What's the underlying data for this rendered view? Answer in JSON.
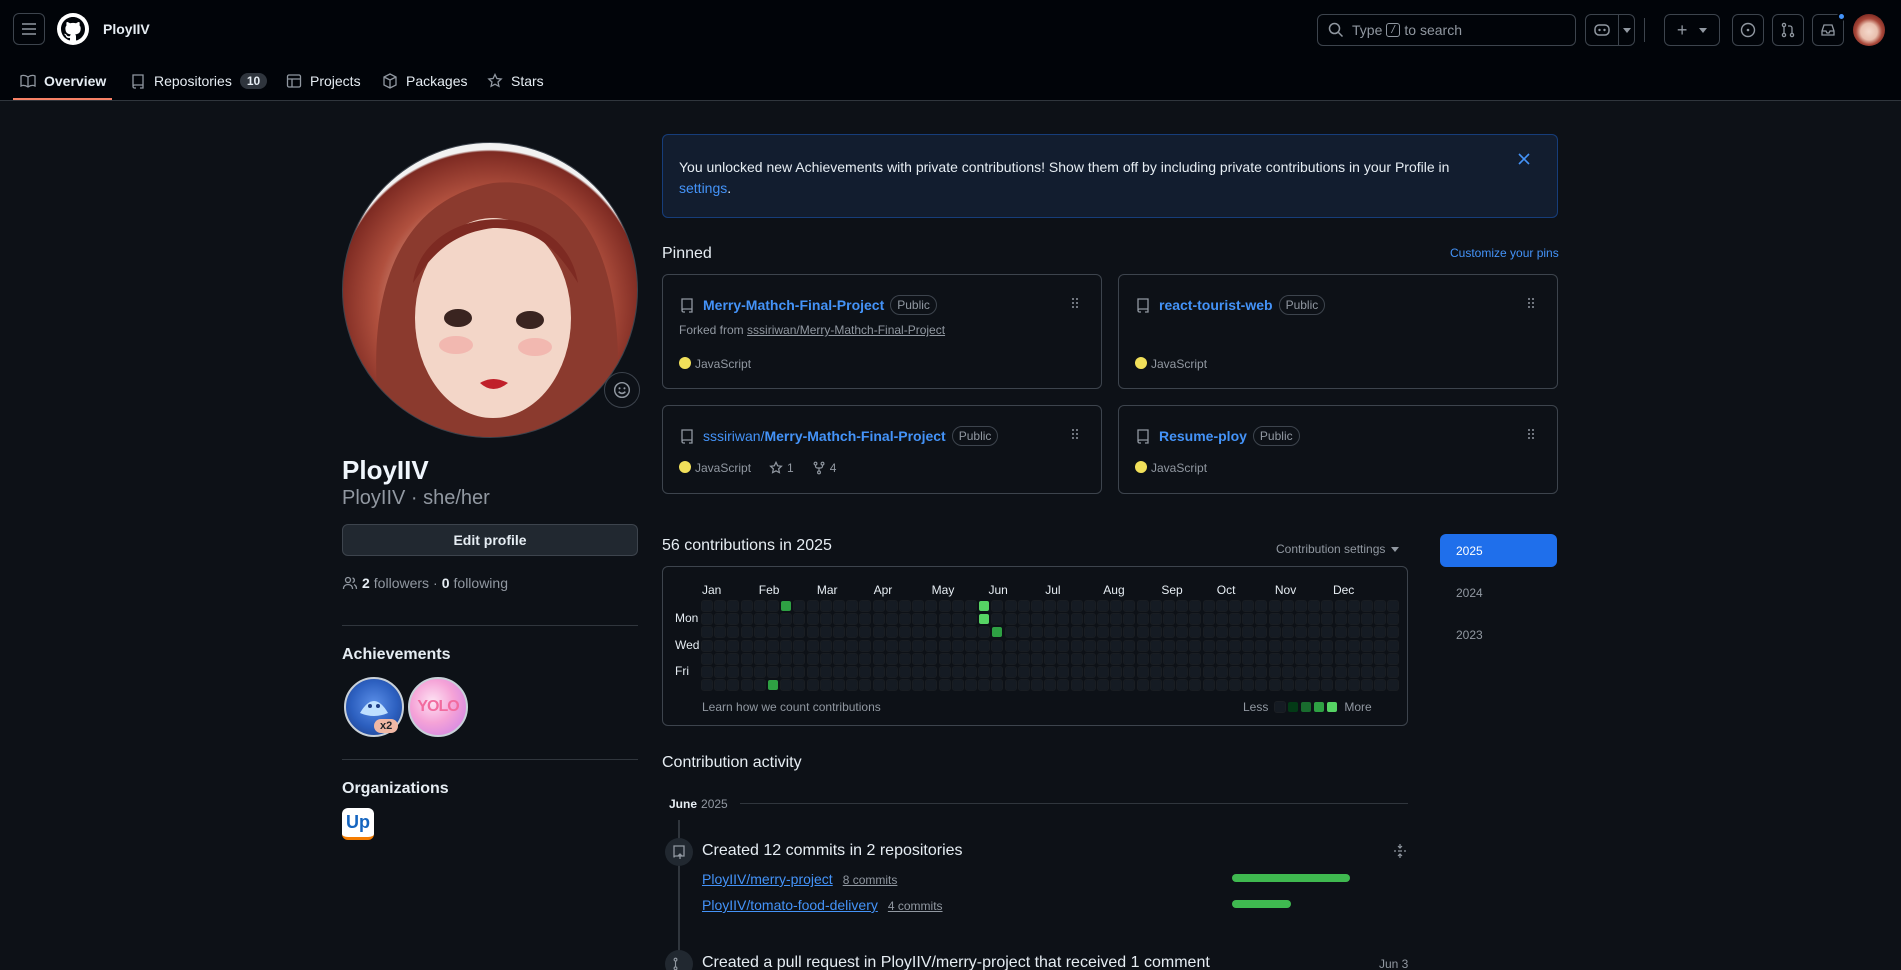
{
  "header": {
    "username": "PloyIIV",
    "search_prefix": "Type",
    "search_key": "/",
    "search_suffix": "to search",
    "plus_label": "+"
  },
  "tabs": [
    {
      "label": "Overview",
      "active": true
    },
    {
      "label": "Repositories",
      "count": "10"
    },
    {
      "label": "Projects"
    },
    {
      "label": "Packages"
    },
    {
      "label": "Stars"
    }
  ],
  "profile": {
    "name": "PloyIIV",
    "subtitle": "PloyIIV · she/her",
    "edit_label": "Edit profile",
    "followers_count": "2",
    "followers_label": "followers",
    "sep": "·",
    "following_count": "0",
    "following_label": "following",
    "achievements_title": "Achievements",
    "achievement_multiplier": "x2",
    "achievement_yolo": "YOLO",
    "organizations_title": "Organizations",
    "org_logo": "Up"
  },
  "banner": {
    "text": "You unlocked new Achievements with private contributions! Show them off by including private contributions in your Profile in",
    "link": "settings",
    "period": "."
  },
  "pinned": {
    "title": "Pinned",
    "customize": "Customize your pins",
    "cards": [
      {
        "name": "Merry-Mathch-Final-Project",
        "badge": "Public",
        "forked_prefix": "Forked from",
        "forked_from": "sssiriwan/Merry-Mathch-Final-Project",
        "lang": "JavaScript"
      },
      {
        "name": "react-tourist-web",
        "badge": "Public",
        "lang": "JavaScript"
      },
      {
        "owner": "sssiriwan/",
        "name": "Merry-Mathch-Final-Project",
        "badge": "Public",
        "lang": "JavaScript",
        "stars": "1",
        "forks": "4"
      },
      {
        "name": "Resume-ploy",
        "badge": "Public",
        "lang": "JavaScript"
      }
    ]
  },
  "contributions": {
    "title": "56 contributions in 2025",
    "settings": "Contribution settings",
    "months": [
      "Jan",
      "Feb",
      "Mar",
      "Apr",
      "May",
      "Jun",
      "Jul",
      "Aug",
      "Sep",
      "Oct",
      "Nov",
      "Dec"
    ],
    "days": [
      "Mon",
      "Wed",
      "Fri"
    ],
    "learn": "Learn how we count contributions",
    "less": "Less",
    "more": "More",
    "years": [
      "2025",
      "2024",
      "2023"
    ],
    "active_cells": [
      {
        "week": 6,
        "day": 0,
        "level": 3
      },
      {
        "week": 5,
        "day": 6,
        "level": 3
      },
      {
        "week": 21,
        "day": 0,
        "level": 4
      },
      {
        "week": 21,
        "day": 1,
        "level": 4
      },
      {
        "week": 22,
        "day": 2,
        "level": 3
      }
    ]
  },
  "activity": {
    "title": "Contribution activity",
    "month": "June",
    "year": "2025",
    "commits_title": "Created 12 commits in 2 repositories",
    "repos": [
      {
        "name": "PloyIIV/merry-project",
        "commits": "8 commits",
        "share": 1.0
      },
      {
        "name": "PloyIIV/tomato-food-delivery",
        "commits": "4 commits",
        "share": 0.5
      }
    ],
    "pr_title": "Created a pull request in PloyIIV/merry-project that received 1 comment",
    "pr_date": "Jun 3"
  },
  "colors": {
    "accent": "#4493f8",
    "green": "#3fb950",
    "year_active": "#1f6feb"
  }
}
